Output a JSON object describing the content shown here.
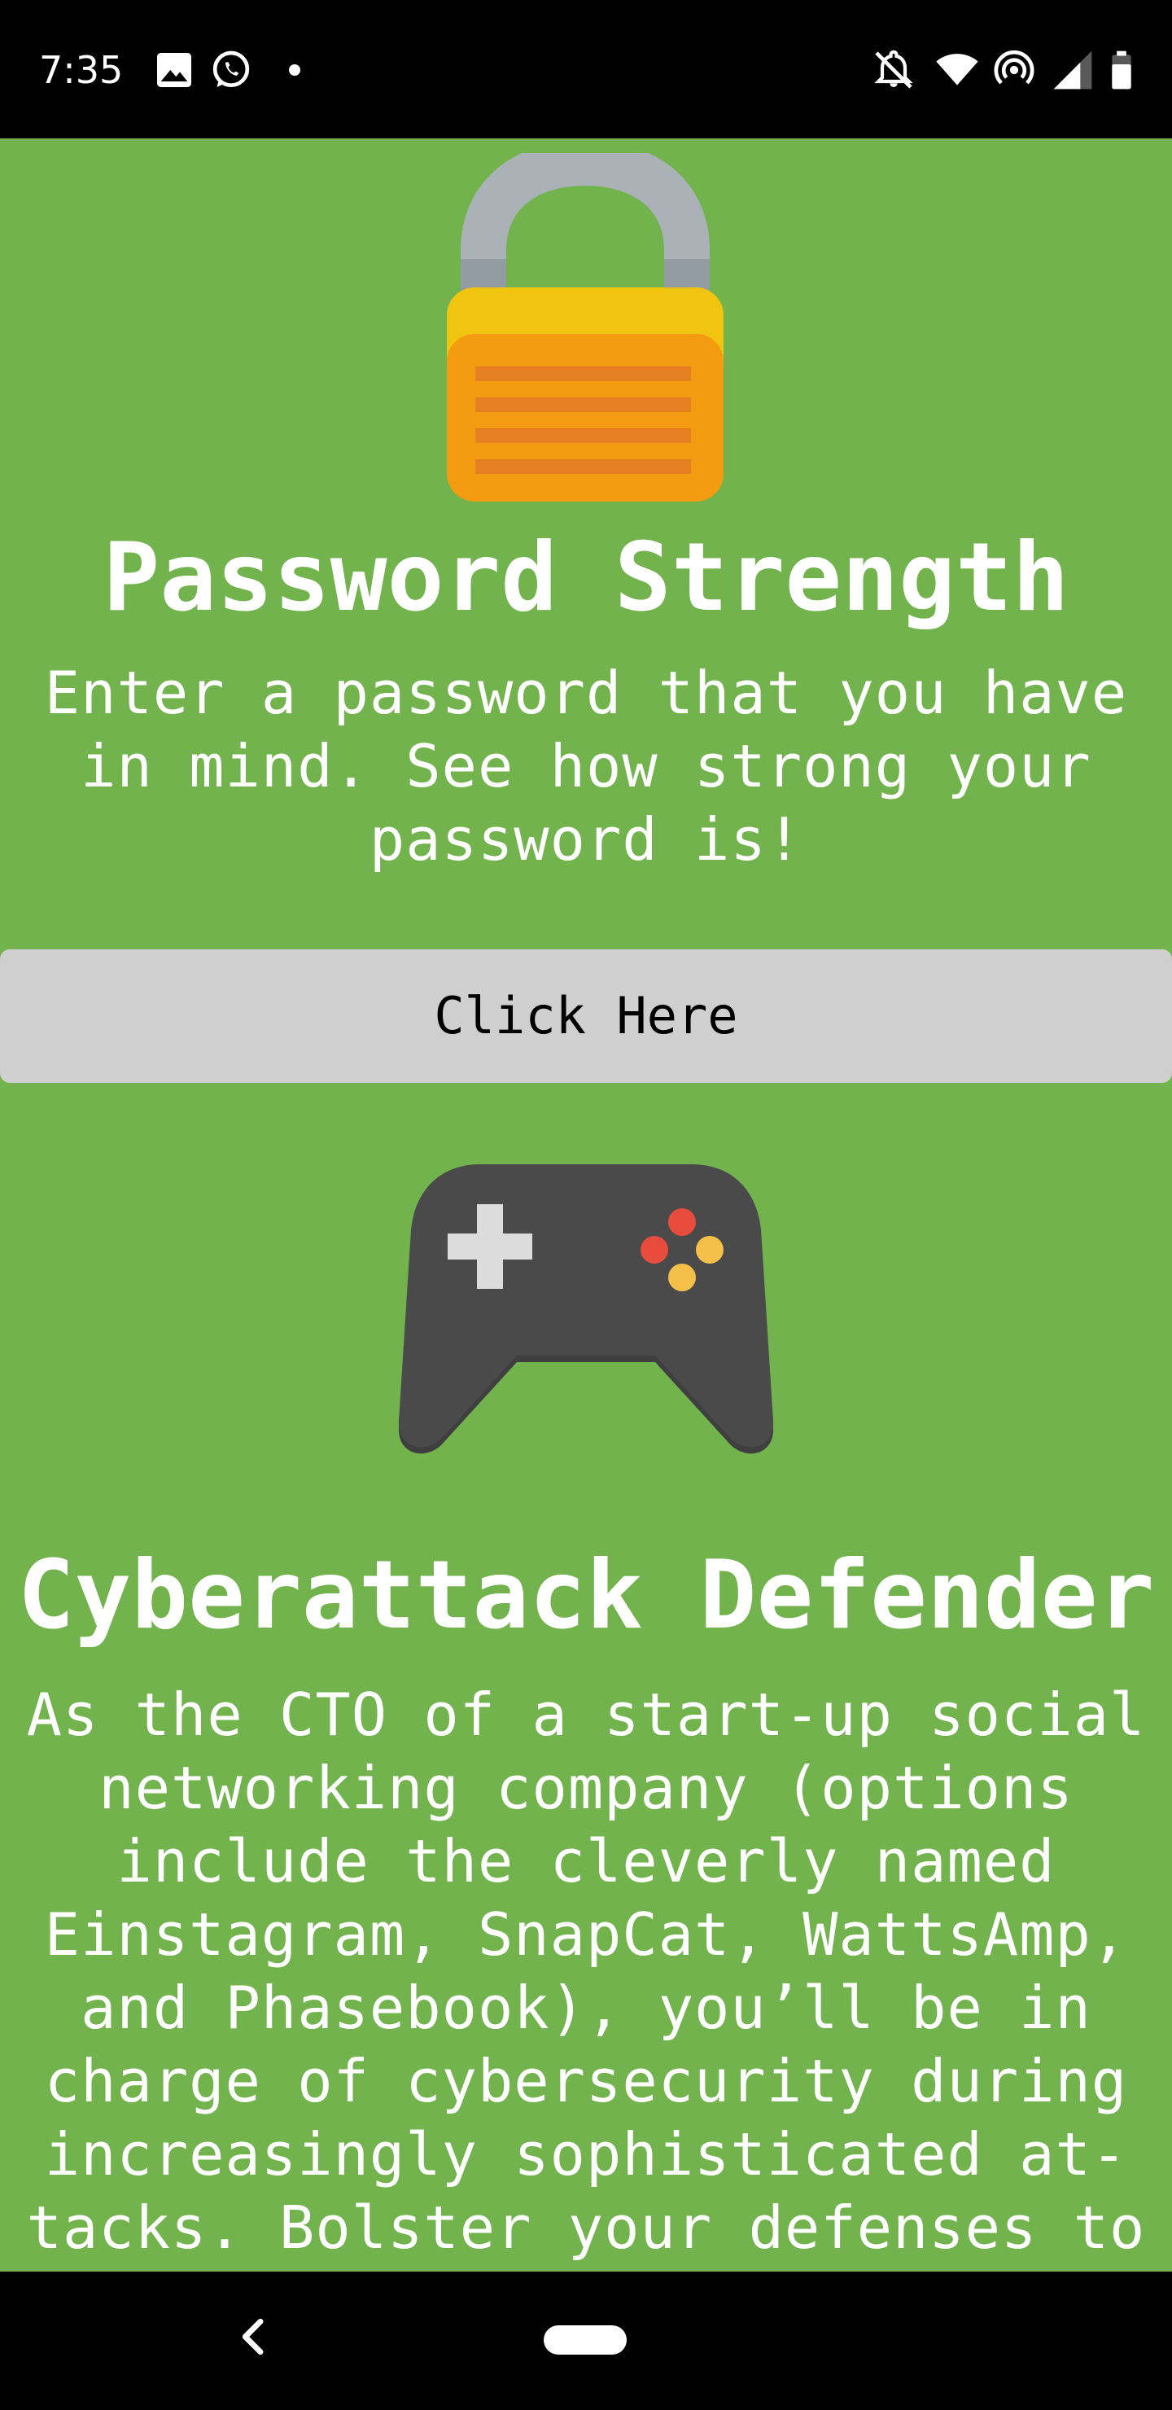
{
  "status_bar": {
    "time": "7:35",
    "left_icons": [
      "image-icon",
      "whatsapp-icon",
      "dot-icon"
    ],
    "right_icons": [
      "notifications-off-icon",
      "wifi-icon",
      "hotspot-icon",
      "cell-signal-icon",
      "battery-icon"
    ]
  },
  "sections": [
    {
      "icon": "lock-icon",
      "title": "Password Strength",
      "description_lines": [
        "Enter a password that you have",
        "in mind. See how strong your",
        "password is!"
      ],
      "button_label": "Click Here"
    },
    {
      "icon": "gamepad-icon",
      "title": "Cyberattack Defender",
      "description_lines": [
        "As the CTO of a start-up social",
        "networking company (options",
        "include the cleverly named",
        "Einstagram, SnapCat, WattsAmp,",
        "and Phasebook), you’ll be in",
        "charge of cybersecurity during",
        "increasingly sophisticated at-",
        "tacks. Bolster your defenses to"
      ]
    }
  ],
  "nav_bar": {
    "icons": [
      "back-icon",
      "home-pill-icon"
    ]
  },
  "colors": {
    "background": "#72b34d",
    "button": "#cfcfcf",
    "lock_body": "#f39c12",
    "lock_top": "#f1c40f",
    "lock_shackle": "#aab2b7",
    "gamepad": "#4a4a4a"
  }
}
